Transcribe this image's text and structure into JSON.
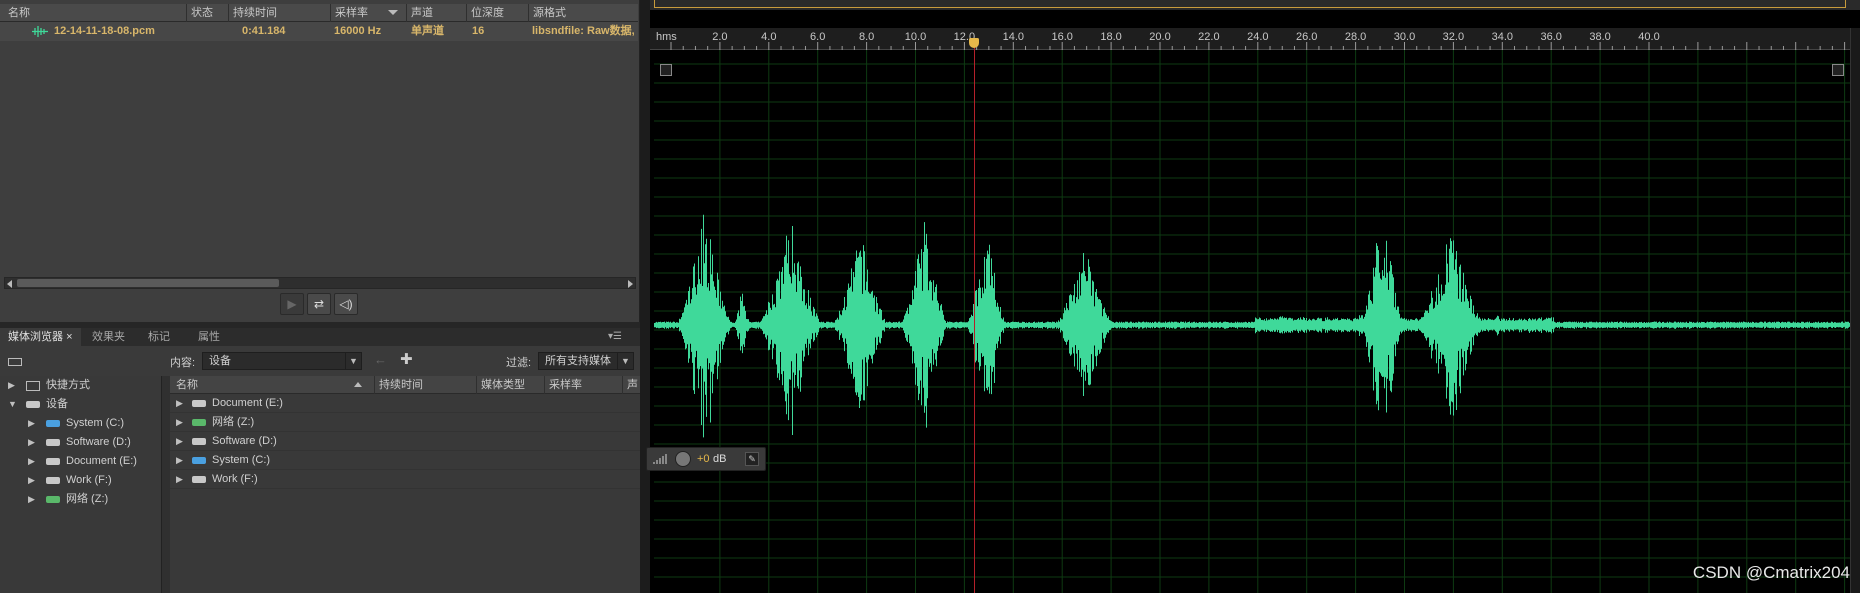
{
  "files_panel": {
    "columns": [
      "名称",
      "状态",
      "持续时间",
      "采样率",
      "声道",
      "位深度",
      "源格式"
    ],
    "file": {
      "name": "12-14-11-18-08.pcm",
      "duration": "0:41.184",
      "sample_rate": "16000 Hz",
      "channels": "单声道",
      "bit_depth": "16",
      "format": "libsndfile: Raw数据,"
    }
  },
  "browser_panel": {
    "tabs": [
      "媒体浏览器",
      "效果夹",
      "标记",
      "属性"
    ],
    "content_label": "内容:",
    "content_value": "设备",
    "filter_label": "过滤:",
    "filter_value": "所有支持媒体",
    "tree": [
      {
        "label": "快捷方式",
        "level": 0,
        "expanded": false
      },
      {
        "label": "设备",
        "level": 0,
        "expanded": true
      },
      {
        "label": "System (C:)",
        "level": 1
      },
      {
        "label": "Software (D:)",
        "level": 1
      },
      {
        "label": "Document (E:)",
        "level": 1
      },
      {
        "label": "Work (F:)",
        "level": 1
      },
      {
        "label": "网络 (Z:)",
        "level": 1
      }
    ],
    "list_columns": [
      "名称",
      "持续时间",
      "媒体类型",
      "采样率",
      "声"
    ],
    "list_rows": [
      "Document (E:)",
      "网络 (Z:)",
      "Software (D:)",
      "System (C:)",
      "Work (F:)"
    ]
  },
  "editor": {
    "ruler_unit": "hms",
    "ruler_ticks": [
      "2.0",
      "4.0",
      "6.0",
      "8.0",
      "10.0",
      "12.0",
      "14.0",
      "16.0",
      "18.0",
      "20.0",
      "22.0",
      "24.0",
      "26.0",
      "28.0",
      "30.0",
      "32.0",
      "34.0",
      "36.0",
      "38.0",
      "40.0"
    ],
    "playhead_seconds": 12.4,
    "volume_prefix": "+0",
    "volume_unit": "dB",
    "waveform_color": "#3fd99a",
    "grid_color": "#0e3a12",
    "playhead_color": "#b4202a"
  },
  "watermark": "CSDN @Cmatrix204"
}
